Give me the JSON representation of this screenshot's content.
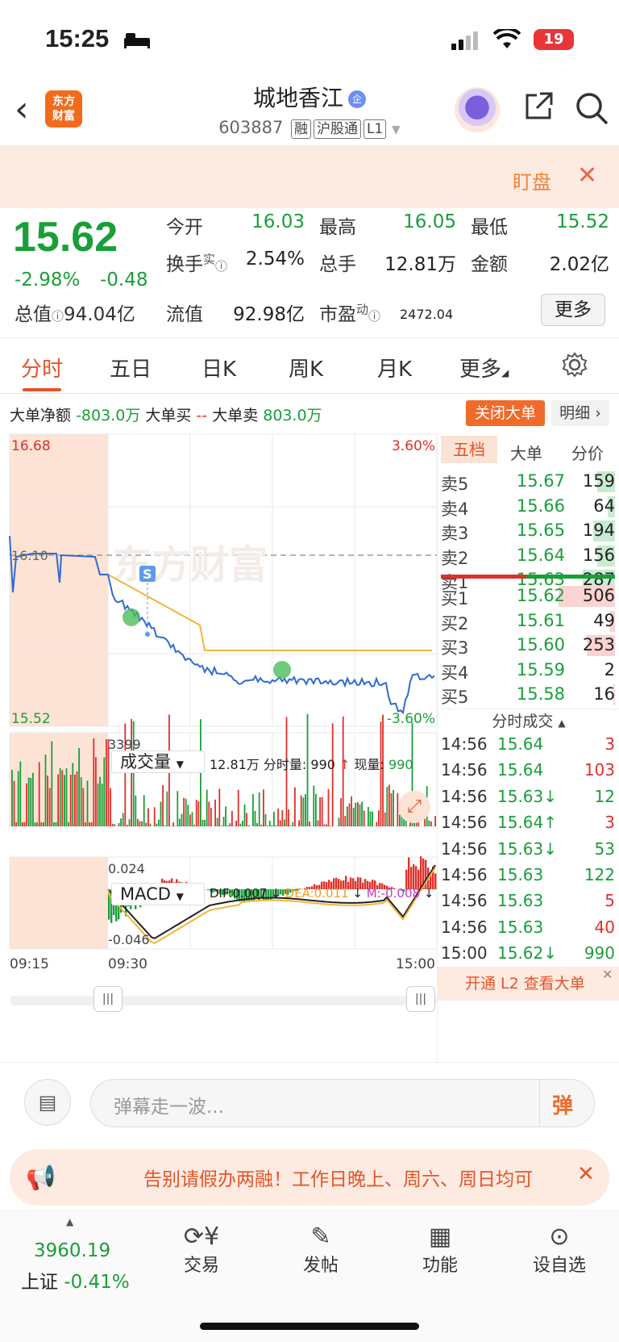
{
  "status": {
    "time": "15:25",
    "battery": "19"
  },
  "header": {
    "logo_line1": "东方",
    "logo_line2": "财富",
    "name": "城地香江",
    "qi_badge": "企",
    "code": "603887",
    "tags": [
      "融",
      "沪股通",
      "L1"
    ]
  },
  "banner": {
    "label": "盯盘"
  },
  "quote": {
    "price": "15.62",
    "pct": "-2.98%",
    "chg": "-0.48",
    "open_label": "今开",
    "open": "16.03",
    "high_label": "最高",
    "high": "16.05",
    "low_label": "最低",
    "low": "15.52",
    "turnover_label": "换手",
    "turnover_sup": "实",
    "turnover": "2.54%",
    "volume_label": "总手",
    "volume": "12.81万",
    "amount_label": "金额",
    "amount": "2.02亿",
    "mcap_label": "总值",
    "mcap": "94.04亿",
    "float_label": "流值",
    "float": "92.98亿",
    "pe_label": "市盈",
    "pe_sup": "动",
    "pe": "2472.04",
    "more": "更多"
  },
  "tabs": [
    "分时",
    "五日",
    "日K",
    "周K",
    "月K",
    "更多"
  ],
  "dadan": {
    "net_label": "大单净额",
    "net": "-803.0万",
    "buy_label": "大单买",
    "buy": "--",
    "sell_label": "大单卖",
    "sell": "803.0万",
    "close_btn": "关闭大单",
    "detail_btn": "明细"
  },
  "chart": {
    "top_left": "16.68",
    "top_right": "3.60%",
    "mid": "16.10",
    "bottom_left": "15.52",
    "bottom_right": "-3.60%",
    "watermark": "东方财富",
    "s_marker": "S",
    "vol_label": "成交量",
    "vol_total": "12.81万",
    "vol_fen_label": "分时量:",
    "vol_fen": "990",
    "vol_now_label": "现量:",
    "vol_now": "990",
    "vol_max": "3399",
    "macd_label": "MACD",
    "dif": "DIF:0.007",
    "dea": "DEA:0.011",
    "m": "M:-0.008",
    "macd_top": "0.024",
    "macd_bottom": "-0.046",
    "time_start": "09:15",
    "time_open": "09:30",
    "time_end": "15:00"
  },
  "orderbook": {
    "tabs": [
      "五档",
      "大单",
      "分价"
    ],
    "sells": [
      {
        "label": "卖5",
        "price": "15.67",
        "vol": "159"
      },
      {
        "label": "卖4",
        "price": "15.66",
        "vol": "64"
      },
      {
        "label": "卖3",
        "price": "15.65",
        "vol": "194"
      },
      {
        "label": "卖2",
        "price": "15.64",
        "vol": "156"
      },
      {
        "label": "卖1",
        "price": "15.63",
        "vol": "287"
      }
    ],
    "buys": [
      {
        "label": "买1",
        "price": "15.62",
        "vol": "506"
      },
      {
        "label": "买2",
        "price": "15.61",
        "vol": "49"
      },
      {
        "label": "买3",
        "price": "15.60",
        "vol": "253"
      },
      {
        "label": "买4",
        "price": "15.59",
        "vol": "2"
      },
      {
        "label": "买5",
        "price": "15.58",
        "vol": "16"
      }
    ]
  },
  "ticks": {
    "title": "分时成交",
    "rows": [
      {
        "t": "14:56",
        "p": "15.64",
        "v": "3",
        "c": "red"
      },
      {
        "t": "14:56",
        "p": "15.64",
        "v": "103",
        "c": "red"
      },
      {
        "t": "14:56",
        "p": "15.63↓",
        "v": "12",
        "c": "green"
      },
      {
        "t": "14:56",
        "p": "15.64↑",
        "v": "3",
        "c": "red"
      },
      {
        "t": "14:56",
        "p": "15.63↓",
        "v": "53",
        "c": "green"
      },
      {
        "t": "14:56",
        "p": "15.63",
        "v": "122",
        "c": "green"
      },
      {
        "t": "14:56",
        "p": "15.63",
        "v": "5",
        "c": "red"
      },
      {
        "t": "14:56",
        "p": "15.63",
        "v": "40",
        "c": "red"
      },
      {
        "t": "15:00",
        "p": "15.62↓",
        "v": "990",
        "c": "green"
      }
    ],
    "promo": "开通 L2 查看大单"
  },
  "comment": {
    "placeholder": "弹幕走一波...",
    "danmu": "弹"
  },
  "ad": {
    "text": "告别请假办两融！工作日晚上、周六、周日均可"
  },
  "bottom": {
    "index_value": "3960.19",
    "index_name": "上证",
    "index_pct": "-0.41%",
    "items": [
      "交易",
      "发帖",
      "功能",
      "设自选"
    ]
  }
}
